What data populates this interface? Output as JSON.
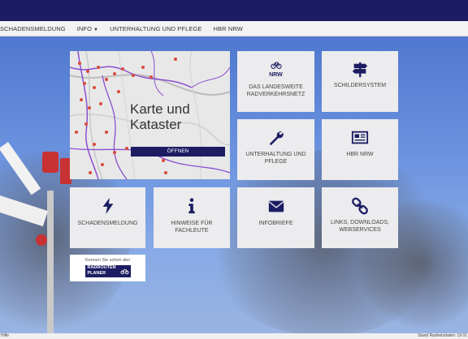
{
  "nav": {
    "items": [
      "SCHADENSMELDUNG",
      "INFO",
      "UNTERHALTUNG UND PFLEGE",
      "HBR NRW"
    ]
  },
  "map_tile": {
    "title_line1": "Karte und",
    "title_line2": "Kataster",
    "button": "ÖFFNEN"
  },
  "tiles": {
    "landesweite": {
      "line1": "DAS LANDESWEITE",
      "line2": "RADVERKEHRSNETZ",
      "icon": "bicycle-icon",
      "icon_text": "NRW"
    },
    "schildersystem": {
      "line1": "SCHILDERSYSTEM",
      "icon": "signpost-icon"
    },
    "unterhaltung": {
      "line1": "UNTERHALTUNG UND",
      "line2": "PFLEGE",
      "icon": "wrench-icon"
    },
    "hbr": {
      "line1": "HBR NRW",
      "icon": "document-icon"
    },
    "schadensmeldung": {
      "line1": "SCHADENSMELDUNG",
      "icon": "lightning-icon"
    },
    "hinweise": {
      "line1": "HINWEISE FÜR",
      "line2": "FACHLEUTE",
      "icon": "info-icon"
    },
    "infobriefe": {
      "line1": "INFOBRIEFE",
      "icon": "envelope-icon"
    },
    "links": {
      "line1": "LINKS, DOWNLOADS,",
      "line2": "WEBSERVICES",
      "icon": "link-icon"
    }
  },
  "radrouten": {
    "label": "Kennen Sie schon den",
    "logo_line1": "RADROUTEN",
    "logo_line2": "PLANER"
  },
  "status": {
    "left": "Hilfe",
    "right": "Stand Radnetzdaten: 19.01"
  },
  "colors": {
    "topbar": "#1c1c63",
    "tile_bg": "#ececee",
    "accent": "#1c1c63"
  }
}
